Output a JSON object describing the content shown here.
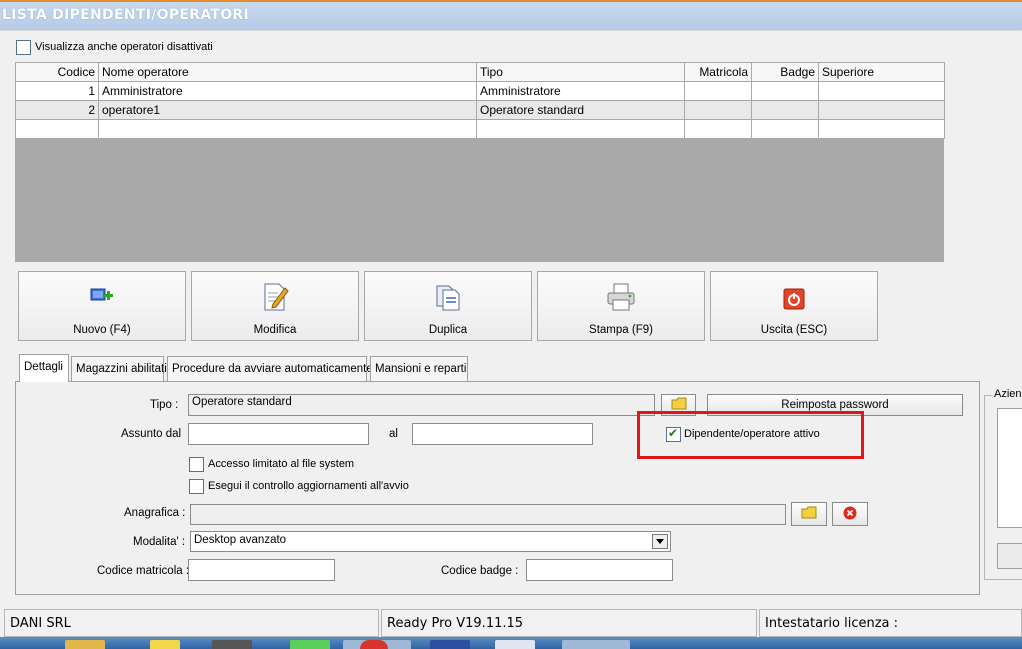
{
  "window": {
    "title": "LISTA DIPENDENTI/OPERATORI"
  },
  "show_disabled": {
    "label": "Visualizza anche operatori disattivati",
    "checked": false
  },
  "grid": {
    "columns": [
      "Codice",
      "Nome operatore",
      "Tipo",
      "Matricola",
      "Badge",
      "Superiore"
    ],
    "rows": [
      [
        "1",
        "Amministratore",
        "Amministratore",
        "",
        "",
        ""
      ],
      [
        "2",
        "operatore1",
        "Operatore standard",
        "",
        "",
        ""
      ],
      [
        "",
        "",
        "",
        "",
        "",
        ""
      ]
    ]
  },
  "toolbar": {
    "new_label": "Nuovo (F4)",
    "edit_label": "Modifica",
    "duplicate_label": "Duplica",
    "print_label": "Stampa (F9)",
    "exit_label": "Uscita (ESC)"
  },
  "tabs": [
    {
      "label": "Dettagli",
      "active": true
    },
    {
      "label": "Magazzini abilitati",
      "active": false
    },
    {
      "label": "Procedure da avviare automaticamente",
      "active": false
    },
    {
      "label": "Mansioni e reparti",
      "active": false
    }
  ],
  "details": {
    "tipo_label": "Tipo :",
    "tipo_value": "Operatore standard",
    "reset_password_label": "Reimposta password",
    "assunto_label": "Assunto dal",
    "assunto_value": "",
    "al_label": "al",
    "al_value": "",
    "active_label": "Dipendente/operatore attivo",
    "active_checked": true,
    "limited_access_label": "Accesso limitato al file system",
    "limited_access_checked": false,
    "update_check_label": "Esegui il controllo aggiornamenti all'avvio",
    "update_check_checked": false,
    "anagrafica_label": "Anagrafica :",
    "anagrafica_value": "",
    "modalita_label": "Modalita' :",
    "modalita_value": "Desktop avanzato",
    "matricola_label": "Codice matricola :",
    "matricola_value": "",
    "badge_label": "Codice badge :",
    "badge_value": ""
  },
  "aziende": {
    "label": "Aziend"
  },
  "status_bar": {
    "company": "DANI SRL",
    "version": "Ready Pro V19.11.15",
    "license": "Intestatario licenza :"
  },
  "colors": {
    "highlight": "#e0161b",
    "title_bg": "#b8cde8",
    "accent": "#e58a2c"
  }
}
